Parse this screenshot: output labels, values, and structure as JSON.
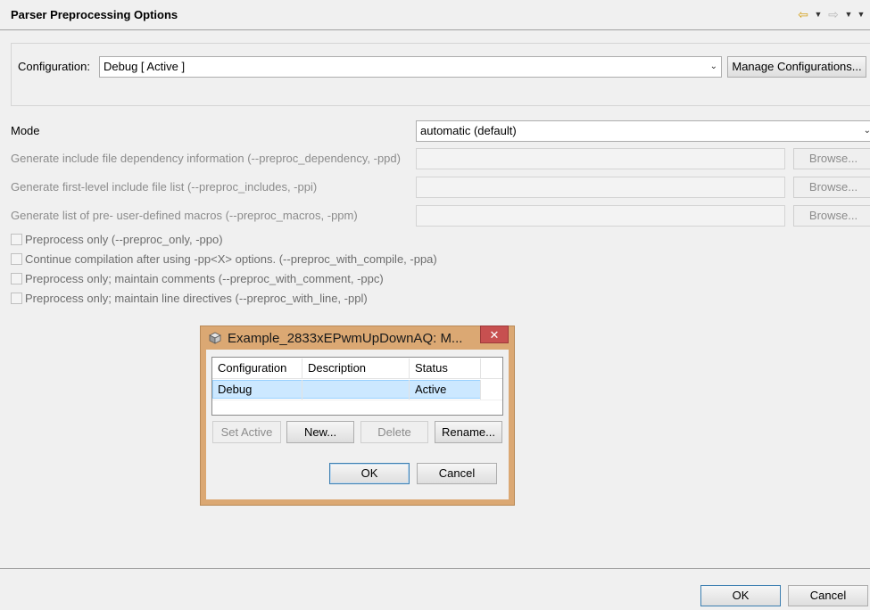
{
  "header": {
    "title": "Parser Preprocessing Options",
    "nav": {
      "back": "⇦",
      "forward": "⇨",
      "dropdown": "▼"
    }
  },
  "configuration": {
    "label": "Configuration:",
    "value": "Debug  [ Active ]",
    "manage_label": "Manage Configurations..."
  },
  "options": {
    "mode_label": "Mode",
    "mode_value": "automatic (default)",
    "fields": [
      {
        "label": "Generate include file dependency information (--preproc_dependency, -ppd)",
        "browse": "Browse..."
      },
      {
        "label": "Generate first-level include file list (--preproc_includes, -ppi)",
        "browse": "Browse..."
      },
      {
        "label": "Generate list of pre-  user-defined macros (--preproc_macros, -ppm)",
        "browse": "Browse..."
      }
    ],
    "checkboxes": [
      "Preprocess only (--preproc_only, -ppo)",
      "Continue compilation after using -pp<X> options. (--preproc_with_compile, -ppa)",
      "Preprocess only; maintain comments (--preproc_with_comment, -ppc)",
      "Preprocess only; maintain line directives (--preproc_with_line, -ppl)"
    ]
  },
  "dialog": {
    "title": "Example_2833xEPwmUpDownAQ: M...",
    "close": "✕",
    "columns": [
      "Configuration",
      "Description",
      "Status"
    ],
    "rows": [
      {
        "configuration": "Debug",
        "description": "",
        "status": "Active"
      }
    ],
    "buttons": {
      "set_active": "Set Active",
      "new": "New...",
      "delete": "Delete",
      "rename": "Rename...",
      "ok": "OK",
      "cancel": "Cancel"
    }
  },
  "footer": {
    "ok": "OK",
    "cancel": "Cancel"
  }
}
